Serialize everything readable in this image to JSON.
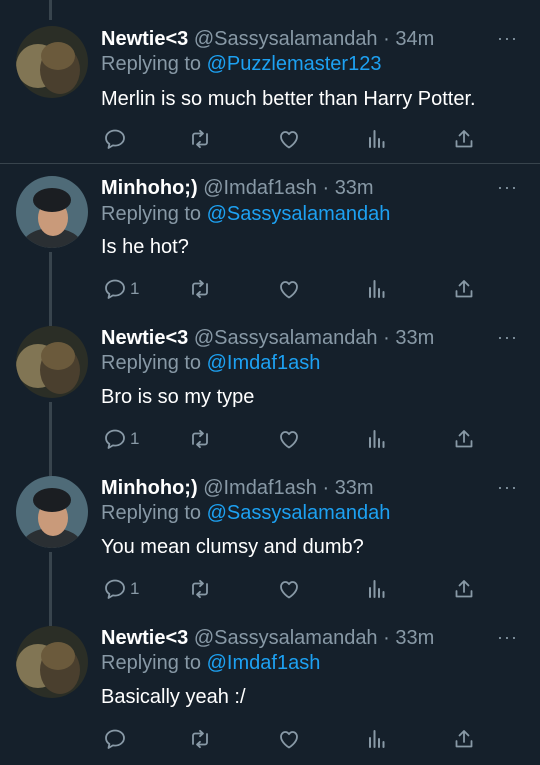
{
  "tweets": [
    {
      "name": "Newtie<3",
      "handle": "@Sassysalamandah",
      "sep": "·",
      "time": "34m",
      "replying_prefix": "Replying to",
      "replying_to": "@Puzzlemaster123",
      "text": "Merlin is so much better than Harry Potter.",
      "reply_count": "",
      "more": "···"
    },
    {
      "name": "Minhoho;)",
      "handle": "@Imdaf1ash",
      "sep": "·",
      "time": "33m",
      "replying_prefix": "Replying to",
      "replying_to": "@Sassysalamandah",
      "text": "Is he hot?",
      "reply_count": "1",
      "more": "···"
    },
    {
      "name": "Newtie<3",
      "handle": "@Sassysalamandah",
      "sep": "·",
      "time": "33m",
      "replying_prefix": "Replying to",
      "replying_to": "@Imdaf1ash",
      "text": "Bro is so my type",
      "reply_count": "1",
      "more": "···"
    },
    {
      "name": "Minhoho;)",
      "handle": "@Imdaf1ash",
      "sep": "·",
      "time": "33m",
      "replying_prefix": "Replying to",
      "replying_to": "@Sassysalamandah",
      "text": "You mean clumsy and dumb?",
      "reply_count": "1",
      "more": "···"
    },
    {
      "name": "Newtie<3",
      "handle": "@Sassysalamandah",
      "sep": "·",
      "time": "33m",
      "replying_prefix": "Replying to",
      "replying_to": "@Imdaf1ash",
      "text": "Basically yeah :/",
      "reply_count": "",
      "more": "···"
    }
  ],
  "icons": {
    "reply": "reply-icon",
    "retweet": "retweet-icon",
    "like": "heart-icon",
    "analytics": "analytics-icon",
    "share": "share-icon"
  },
  "colors": {
    "background": "#15202b",
    "secondary_text": "#8899a6",
    "mention": "#1da1f2",
    "divider": "#38444d"
  }
}
